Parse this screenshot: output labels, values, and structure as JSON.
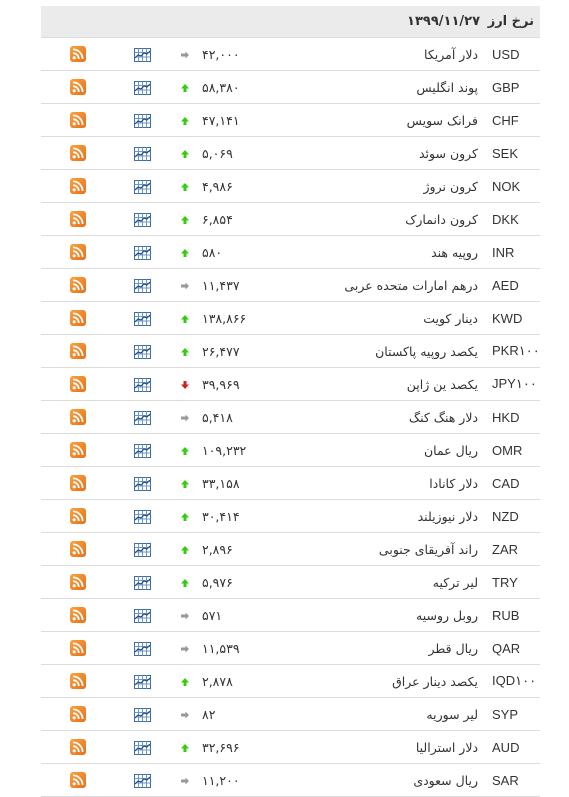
{
  "header": {
    "title": "نرخ ارز",
    "date": "۱۳۹۹/۱۱/۲۷"
  },
  "colors": {
    "up": "#33cc11",
    "down": "#cc2222",
    "neutral": "#999999",
    "rss": "#f7931e",
    "chart": "#3a6ea5"
  },
  "icons": {
    "up": "arrow-up-icon",
    "down": "arrow-down-icon",
    "neutral": "arrow-right-icon",
    "chart": "chart-icon",
    "rss": "rss-icon"
  },
  "rows": [
    {
      "code": "USD",
      "name": "دلار آمریکا",
      "value": "۴۲,۰۰۰",
      "trend": "neutral"
    },
    {
      "code": "GBP",
      "name": "پوند انگلیس",
      "value": "۵۸,۳۸۰",
      "trend": "up"
    },
    {
      "code": "CHF",
      "name": "فرانک سویس",
      "value": "۴۷,۱۴۱",
      "trend": "up"
    },
    {
      "code": "SEK",
      "name": "کرون سوئد",
      "value": "۵,۰۶۹",
      "trend": "up"
    },
    {
      "code": "NOK",
      "name": "کرون نروژ",
      "value": "۴,۹۸۶",
      "trend": "up"
    },
    {
      "code": "DKK",
      "name": "کرون دانمارک",
      "value": "۶,۸۵۴",
      "trend": "up"
    },
    {
      "code": "INR",
      "name": "روپیه هند",
      "value": "۵۸۰",
      "trend": "up"
    },
    {
      "code": "AED",
      "name": "درهم امارات متحده عربی",
      "value": "۱۱,۴۳۷",
      "trend": "neutral"
    },
    {
      "code": "KWD",
      "name": "دینار کویت",
      "value": "۱۳۸,۸۶۶",
      "trend": "up"
    },
    {
      "code": "PKR۱۰۰",
      "name": "یکصد روپیه پاکستان",
      "value": "۲۶,۴۷۷",
      "trend": "up"
    },
    {
      "code": "JPY۱۰۰",
      "name": "یکصد ین ژاپن",
      "value": "۳۹,۹۶۹",
      "trend": "down"
    },
    {
      "code": "HKD",
      "name": "دلار هنگ کنگ",
      "value": "۵,۴۱۸",
      "trend": "neutral"
    },
    {
      "code": "OMR",
      "name": "ریال عمان",
      "value": "۱۰۹,۲۳۲",
      "trend": "up"
    },
    {
      "code": "CAD",
      "name": "دلار کانادا",
      "value": "۳۳,۱۵۸",
      "trend": "up"
    },
    {
      "code": "NZD",
      "name": "دلار نیوزیلند",
      "value": "۳۰,۴۱۴",
      "trend": "up"
    },
    {
      "code": "ZAR",
      "name": "راند آفریقای جنوبی",
      "value": "۲,۸۹۶",
      "trend": "up"
    },
    {
      "code": "TRY",
      "name": "لیر ترکیه",
      "value": "۵,۹۷۶",
      "trend": "up"
    },
    {
      "code": "RUB",
      "name": "روبل روسیه",
      "value": "۵۷۱",
      "trend": "neutral"
    },
    {
      "code": "QAR",
      "name": "ریال قطر",
      "value": "۱۱,۵۳۹",
      "trend": "neutral"
    },
    {
      "code": "IQD۱۰۰",
      "name": "یکصد دینار عراق",
      "value": "۲,۸۷۸",
      "trend": "up"
    },
    {
      "code": "SYP",
      "name": "لیر سوریه",
      "value": "۸۲",
      "trend": "neutral"
    },
    {
      "code": "AUD",
      "name": "دلار استرالیا",
      "value": "۳۲,۶۹۶",
      "trend": "up"
    },
    {
      "code": "SAR",
      "name": "ریال سعودی",
      "value": "۱۱,۲۰۰",
      "trend": "neutral"
    }
  ]
}
